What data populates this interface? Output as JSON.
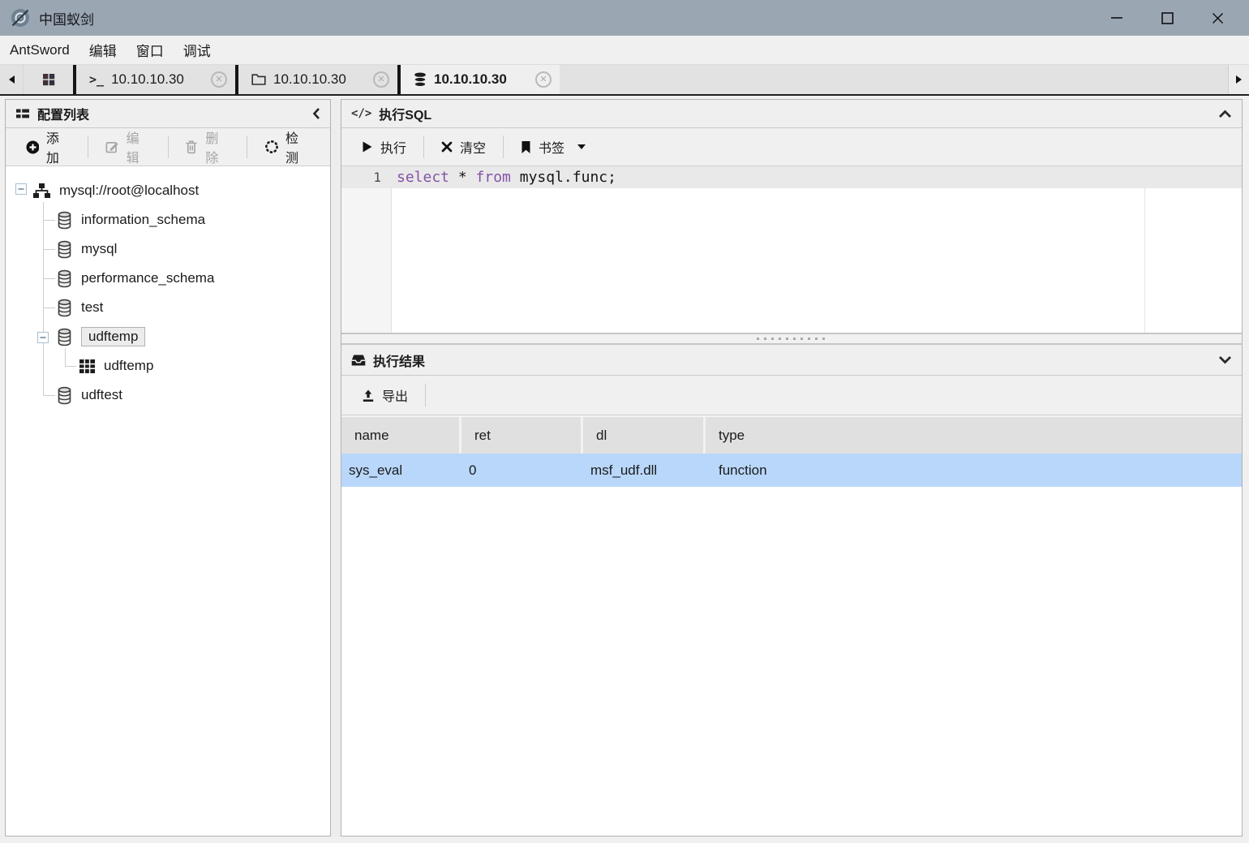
{
  "window": {
    "title": "中国蚁剑"
  },
  "menu": {
    "items": [
      "AntSword",
      "编辑",
      "窗口",
      "调试"
    ]
  },
  "icons": {
    "close_tab": "✕",
    "terminal": ">_",
    "code": "</>"
  },
  "tabs": {
    "items": [
      {
        "label": "10.10.10.30",
        "type": "terminal"
      },
      {
        "label": "10.10.10.30",
        "type": "file-manager"
      },
      {
        "label": "10.10.10.30",
        "type": "database",
        "active": true
      }
    ]
  },
  "sidebar": {
    "title": "配置列表",
    "toolbar": {
      "add": "添加",
      "edit": "编辑",
      "delete": "删除",
      "check": "检测"
    },
    "tree": {
      "root": "mysql://root@localhost",
      "databases": [
        "information_schema",
        "mysql",
        "performance_schema",
        "test",
        "udftemp",
        "udftest"
      ],
      "selected": "udftemp",
      "udftemp_table": "udftemp"
    }
  },
  "sql_panel": {
    "title": "执行SQL",
    "toolbar": {
      "run": "执行",
      "clear": "清空",
      "bookmark": "书签"
    },
    "editor": {
      "line_number": "1",
      "segments": [
        {
          "text": "select",
          "keyword": true
        },
        {
          "text": " * ",
          "keyword": false
        },
        {
          "text": "from",
          "keyword": true
        },
        {
          "text": " mysql.func;",
          "keyword": false
        }
      ]
    }
  },
  "results_panel": {
    "title": "执行结果",
    "toolbar": {
      "export": "导出"
    },
    "table": {
      "columns": [
        "name",
        "ret",
        "dl",
        "type"
      ],
      "rows": [
        [
          "sys_eval",
          "0",
          "msf_udf.dll",
          "function"
        ]
      ]
    }
  },
  "colors": {
    "titlebar": "#9ba6b3",
    "selected_row": "#b9d7fa",
    "keyword": "#8552a8",
    "tab_underline": "#1f1f1f"
  }
}
